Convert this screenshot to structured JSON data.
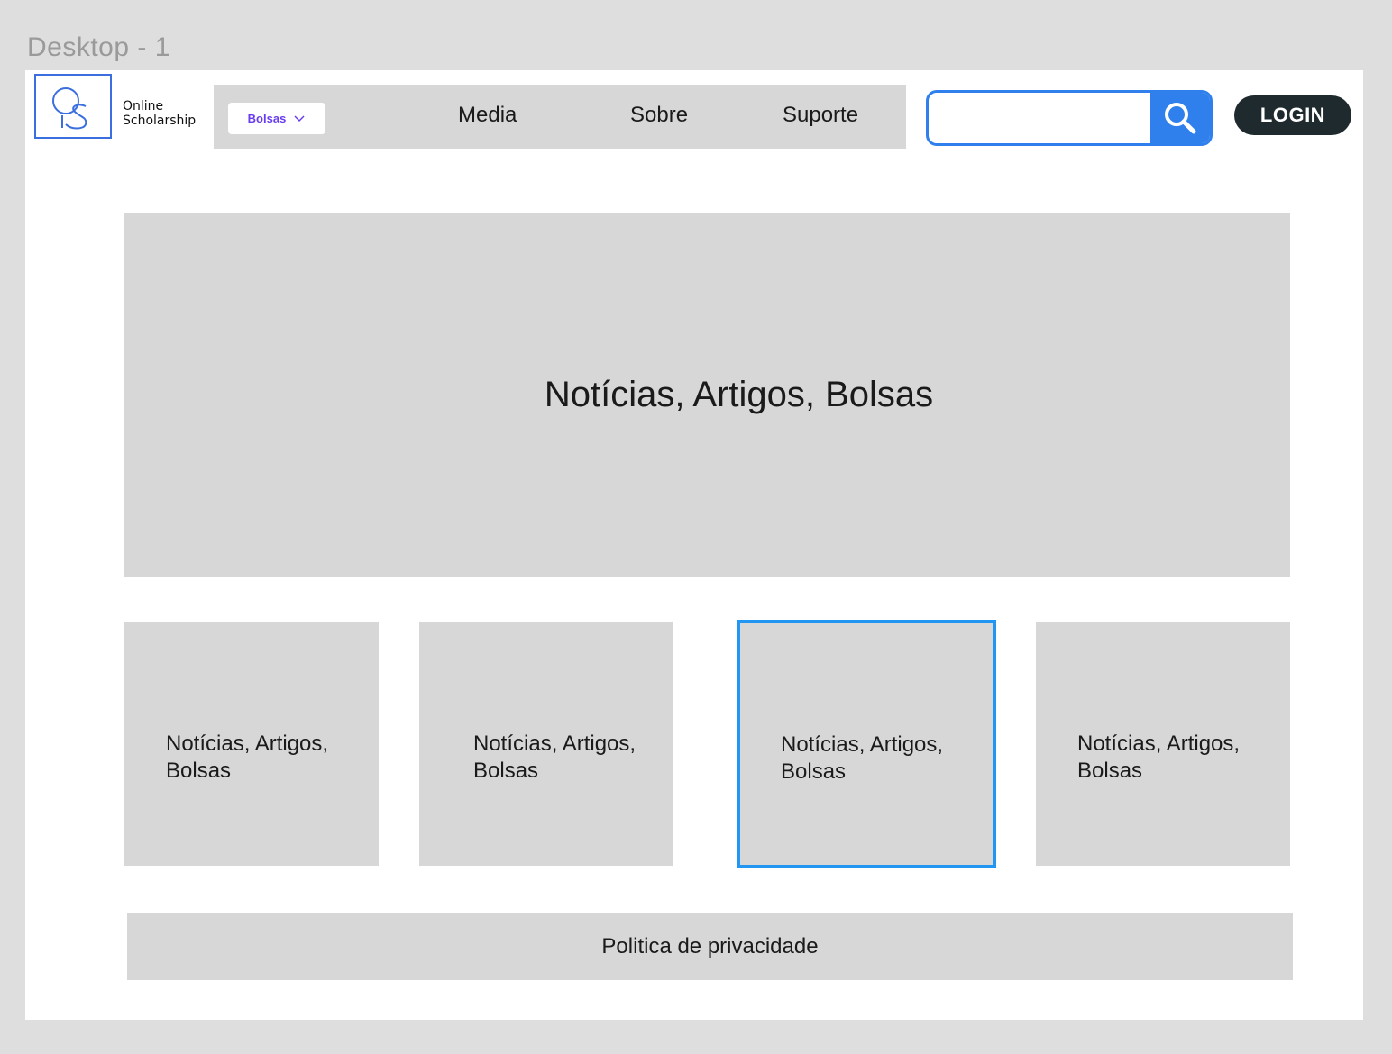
{
  "frame": {
    "label": "Desktop - 1"
  },
  "header": {
    "logo_text_line1": "Online",
    "logo_text_line2": "Scholarship",
    "logo_icon": "os-monogram-logo",
    "dropdown_label": "Bolsas",
    "nav": [
      {
        "label": "Media"
      },
      {
        "label": "Sobre"
      },
      {
        "label": "Suporte"
      }
    ],
    "search_placeholder": "",
    "search_value": "",
    "search_icon": "search-icon",
    "login_label": "LOGIN"
  },
  "hero": {
    "title": "Notícias, Artigos, Bolsas"
  },
  "cards": [
    {
      "label": "Notícias, Artigos, Bolsas",
      "selected": false
    },
    {
      "label": "Notícias, Artigos, Bolsas",
      "selected": false
    },
    {
      "label": "Notícias, Artigos, Bolsas",
      "selected": true
    },
    {
      "label": "Notícias, Artigos, Bolsas",
      "selected": false
    }
  ],
  "footer": {
    "label": "Politica de privacidade"
  },
  "colors": {
    "accent_blue": "#2f80ed",
    "selection_blue": "#2196f3",
    "dropdown_text": "#6a3cf0",
    "login_bg": "#1f2a2e",
    "placeholder_gray": "#d7d7d7"
  }
}
